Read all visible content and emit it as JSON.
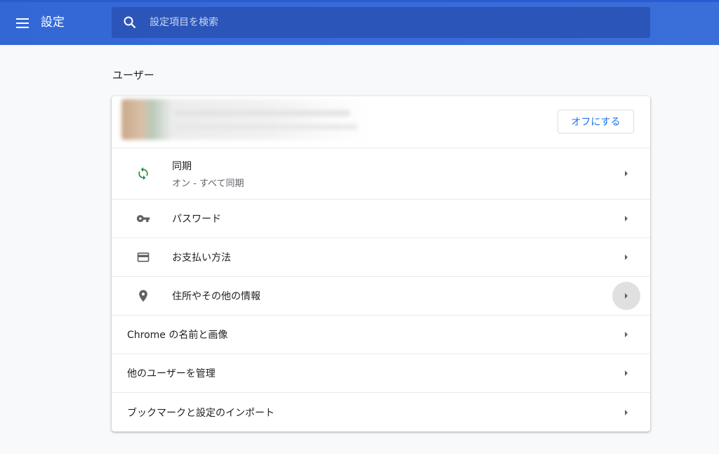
{
  "header": {
    "title": "設定",
    "menu_icon": "hamburger-menu-icon",
    "search_placeholder": "設定項目を検索"
  },
  "section": {
    "title": "ユーザー"
  },
  "account": {
    "off_button_label": "オフにする"
  },
  "rows": [
    {
      "icon": "sync-icon",
      "label": "同期",
      "sublabel": "オン - すべて同期"
    },
    {
      "icon": "key-icon",
      "label": "パスワード"
    },
    {
      "icon": "credit-card-icon",
      "label": "お支払い方法"
    },
    {
      "icon": "location-pin-icon",
      "label": "住所やその他の情報"
    },
    {
      "label": "Chrome の名前と画像"
    },
    {
      "label": "他のユーザーを管理"
    },
    {
      "label": "ブックマークと設定のインポート"
    }
  ],
  "colors": {
    "header_bg": "#3367d6",
    "search_bg": "#2b55b8",
    "accent": "#1a73e8",
    "sync_green": "#1e8e3e",
    "icon_gray": "#5f6368"
  }
}
